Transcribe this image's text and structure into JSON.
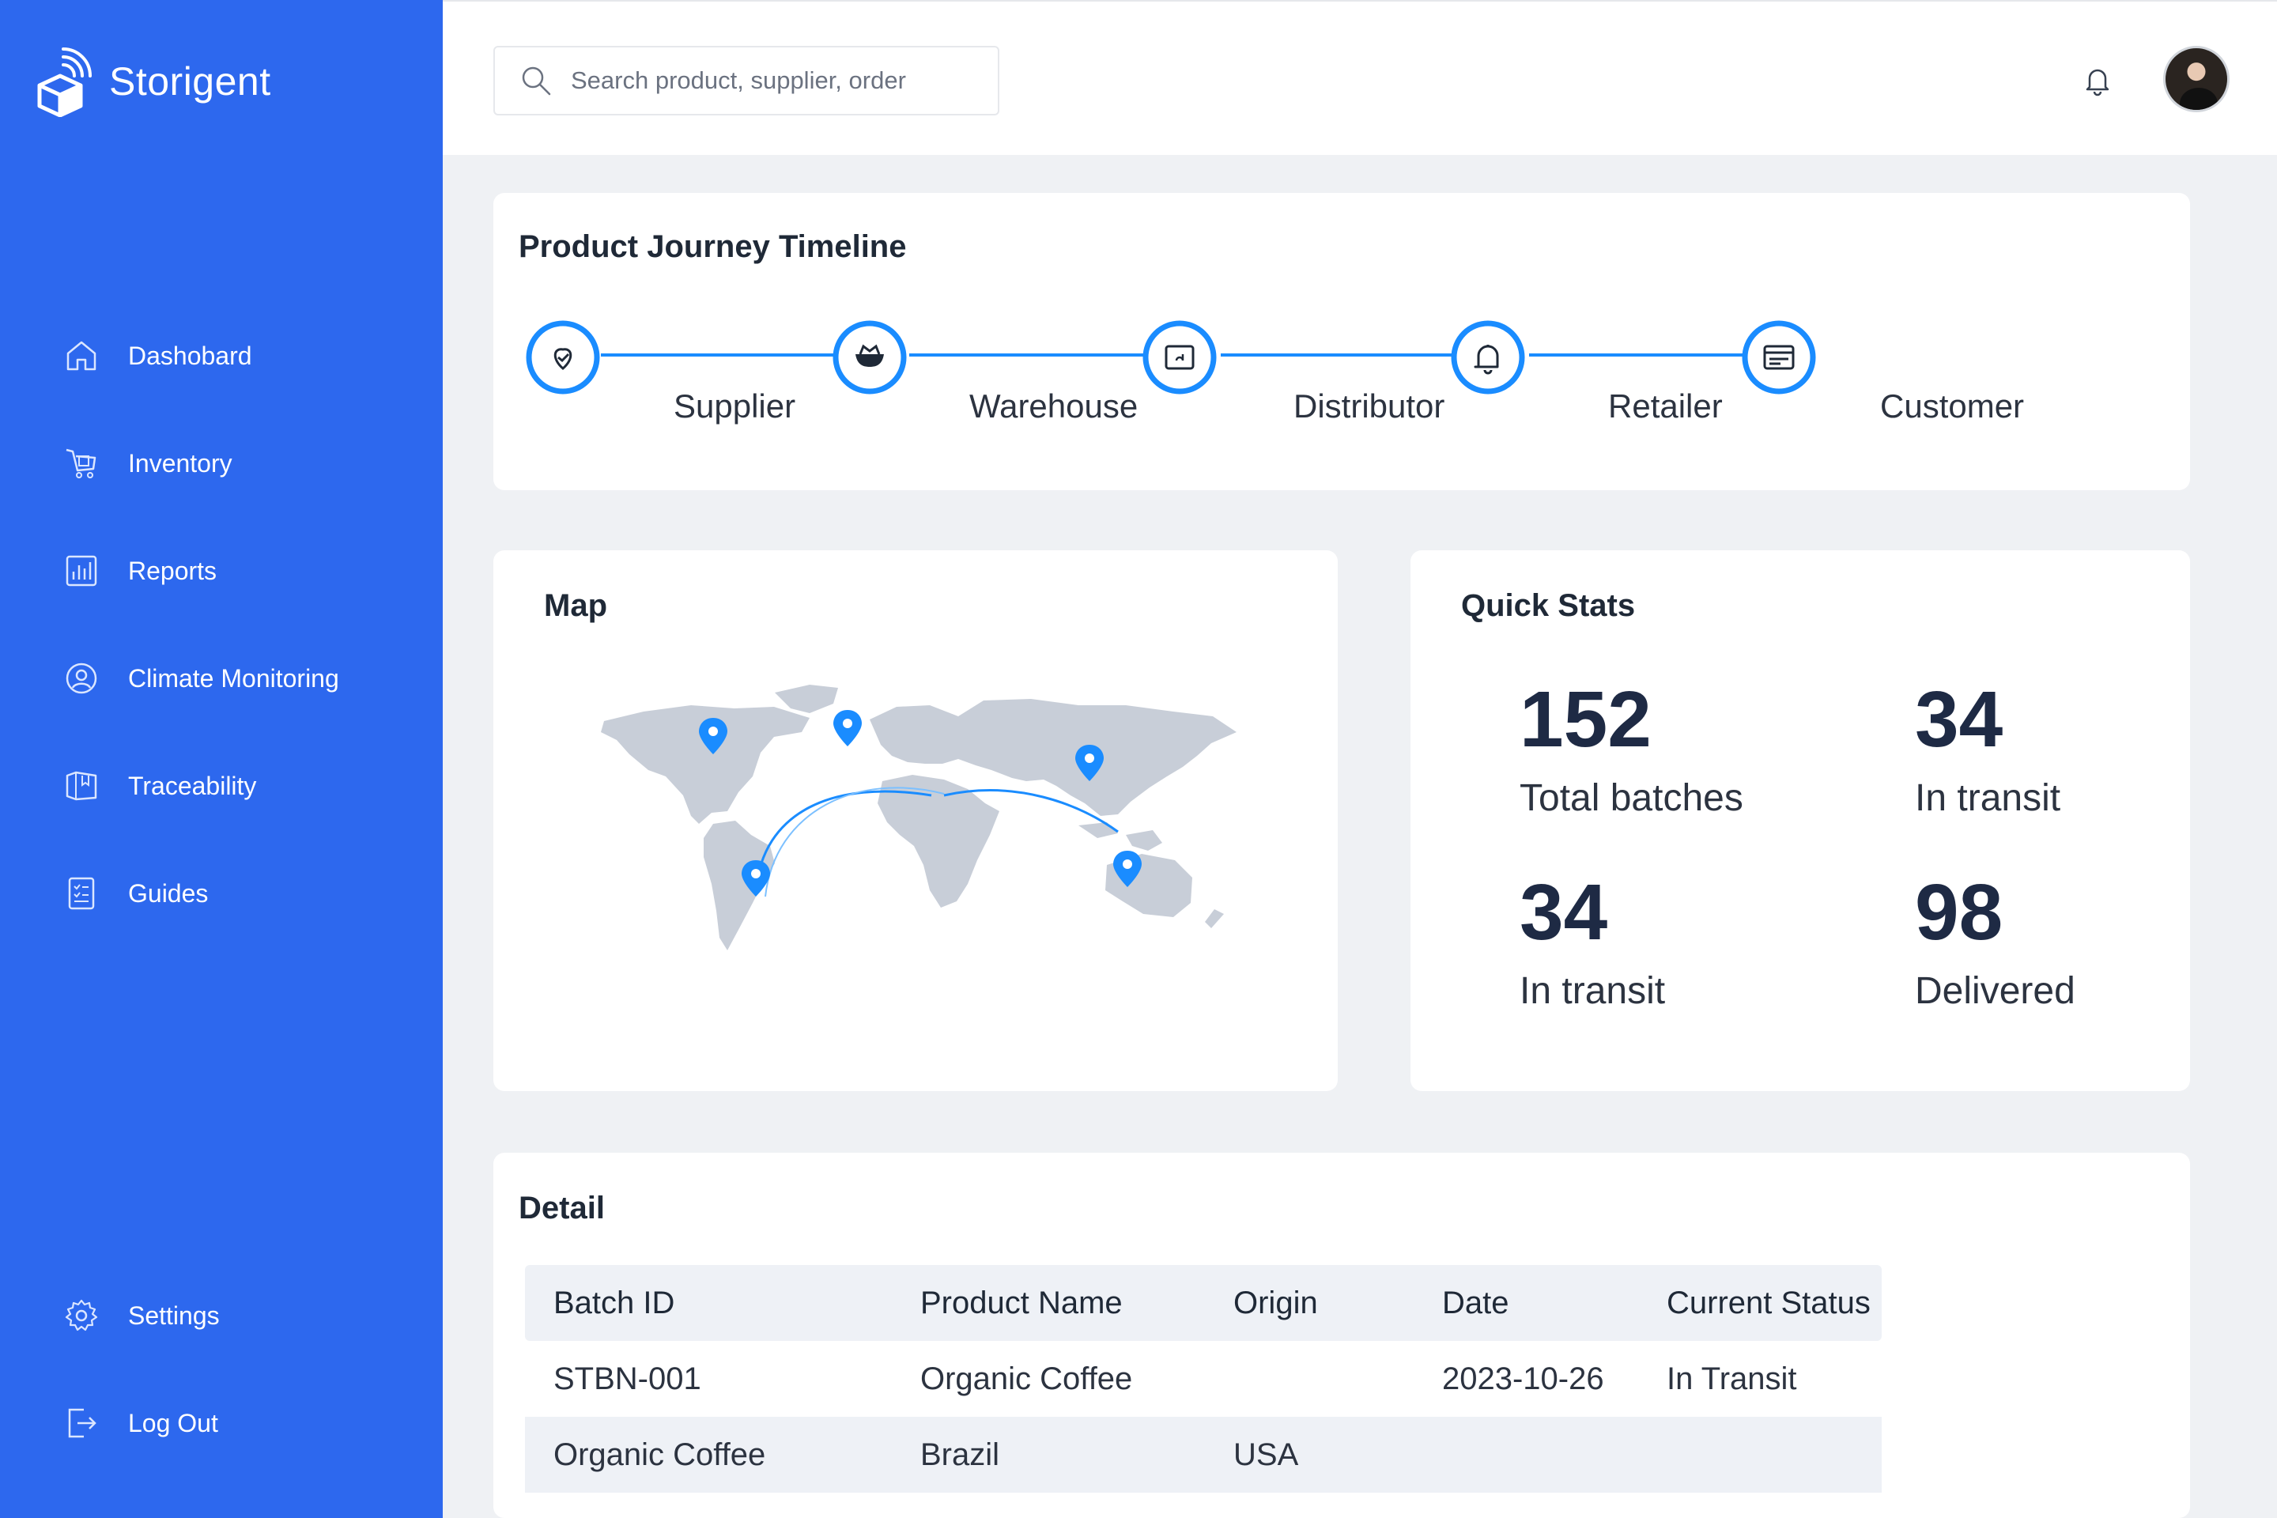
{
  "app": {
    "name": "Storigent"
  },
  "search": {
    "placeholder": "Search product, supplier, order"
  },
  "sidebar": {
    "items": [
      {
        "label": "Dashobard",
        "icon": "home-icon"
      },
      {
        "label": "Inventory",
        "icon": "cart-icon"
      },
      {
        "label": "Reports",
        "icon": "bar-chart-icon"
      },
      {
        "label": "Climate Monitoring",
        "icon": "user-circle-icon"
      },
      {
        "label": "Traceability",
        "icon": "box-icon"
      },
      {
        "label": "Guides",
        "icon": "checklist-icon"
      }
    ],
    "bottom": [
      {
        "label": "Settings",
        "icon": "gear-icon"
      },
      {
        "label": "Log Out",
        "icon": "logout-icon"
      }
    ]
  },
  "timeline": {
    "title": "Product Journey Timeline",
    "stages": [
      {
        "label": "Supplier",
        "icon": "heart-pin-icon"
      },
      {
        "label": "Warehouse",
        "icon": "bowl-icon"
      },
      {
        "label": "Distributor",
        "icon": "screen-icon"
      },
      {
        "label": "Retailer",
        "icon": "bell-icon"
      },
      {
        "label": "Customer",
        "icon": "card-icon"
      }
    ],
    "accent": "#1a8cff"
  },
  "map": {
    "title": "Map",
    "pin_color": "#1a8cff"
  },
  "stats": {
    "title": "Quick Stats",
    "items": [
      {
        "value": "152",
        "label": "Total batches"
      },
      {
        "value": "34",
        "label": "In transit"
      },
      {
        "value": "34",
        "label": "In transit"
      },
      {
        "value": "98",
        "label": "Delivered"
      }
    ]
  },
  "detail": {
    "title": "Detail",
    "columns": [
      "Batch ID",
      "Product Name",
      "Origin",
      "Date",
      "Current Status"
    ],
    "rows": [
      [
        "STBN-001",
        "Organic Coffee",
        "",
        "2023-10-26",
        "In Transit"
      ],
      [
        "Organic Coffee",
        "Brazil",
        "USA",
        "",
        ""
      ]
    ]
  },
  "colors": {
    "sidebar": "#2d68ee",
    "background": "#eff1f4",
    "accent": "#1a8cff"
  }
}
